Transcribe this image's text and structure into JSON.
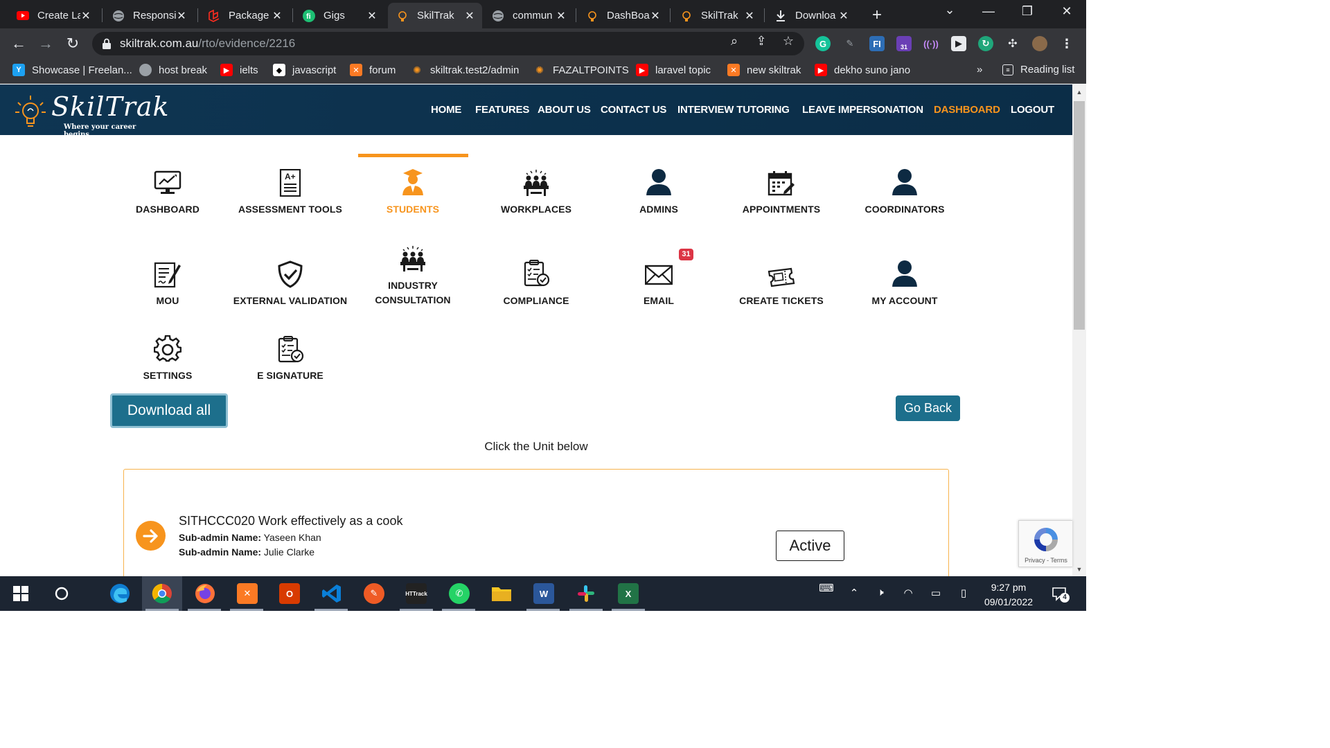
{
  "browser": {
    "tabs": [
      {
        "title": "Create La",
        "icon": "youtube-icon"
      },
      {
        "title": "Responsi",
        "icon": "globe-icon"
      },
      {
        "title": "Package",
        "icon": "laravel-icon"
      },
      {
        "title": "Gigs",
        "icon": "fiverr-icon"
      },
      {
        "title": "SkilTrak",
        "icon": "skiltrak-icon"
      },
      {
        "title": "commun",
        "icon": "globe-icon"
      },
      {
        "title": "DashBoa",
        "icon": "skiltrak-icon"
      },
      {
        "title": "SkilTrak",
        "icon": "skiltrak-icon"
      },
      {
        "title": "Downloa",
        "icon": "download-icon"
      }
    ],
    "url_host": "skiltrak.com.au",
    "url_path": "/rto/evidence/2216",
    "bookmarks": [
      {
        "label": "Showcase | Freelan...",
        "icon": "freelancer-icon"
      },
      {
        "label": "host break",
        "icon": "globe-icon"
      },
      {
        "label": "ielts",
        "icon": "youtube-icon"
      },
      {
        "label": "javascript",
        "icon": "bookmark-icon"
      },
      {
        "label": "forum",
        "icon": "xampp-icon"
      },
      {
        "label": "skiltrak.test2/admin",
        "icon": "skiltrak-icon"
      },
      {
        "label": "FAZALTPOINTS",
        "icon": "skiltrak-icon"
      },
      {
        "label": "laravel topic",
        "icon": "youtube-icon"
      },
      {
        "label": "new skiltrak",
        "icon": "xampp-icon"
      },
      {
        "label": "dekho suno jano",
        "icon": "youtube-icon"
      }
    ],
    "bookmarks_overflow": "»",
    "reading_list": "Reading list",
    "ext_calendar_badge": "31"
  },
  "site": {
    "logo_text": "SkilTrak",
    "logo_tagline": "Where your career begins",
    "nav": [
      "HOME",
      "FEATURES",
      "ABOUT US",
      "CONTACT US",
      "INTERVIEW TUTORING",
      "LEAVE IMPERSONATION",
      "DASHBOARD",
      "LOGOUT"
    ],
    "active_nav": "DASHBOARD",
    "accent_color": "#f7941d",
    "header_color": "#0e3552"
  },
  "dashboard": {
    "items": [
      {
        "label": "DASHBOARD",
        "icon": "dashboard-monitor-icon"
      },
      {
        "label": "ASSESSMENT TOOLS",
        "icon": "assessment-tools-icon"
      },
      {
        "label": "STUDENTS",
        "icon": "student-icon"
      },
      {
        "label": "WORKPLACES",
        "icon": "workplaces-icon"
      },
      {
        "label": "ADMINS",
        "icon": "user-icon"
      },
      {
        "label": "APPOINTMENTS",
        "icon": "calendar-icon"
      },
      {
        "label": "COORDINATORS",
        "icon": "user-icon"
      },
      {
        "label": "MOU",
        "icon": "mou-document-icon"
      },
      {
        "label": "EXTERNAL VALIDATION",
        "icon": "shield-check-icon"
      },
      {
        "label": "INDUSTRY CONSULTATION",
        "icon": "meeting-icon"
      },
      {
        "label": "COMPLIANCE",
        "icon": "clipboard-check-icon"
      },
      {
        "label": "EMAIL",
        "icon": "envelope-icon"
      },
      {
        "label": "CREATE TICKETS",
        "icon": "ticket-icon"
      },
      {
        "label": "MY ACCOUNT",
        "icon": "user-icon"
      },
      {
        "label": "SETTINGS",
        "icon": "gear-icon"
      },
      {
        "label": "E SIGNATURE",
        "icon": "clipboard-check-icon"
      }
    ],
    "selected": "STUDENTS",
    "email_badge": "31"
  },
  "main": {
    "download_all": "Download all",
    "go_back": "Go Back",
    "click_unit": "Click the Unit below",
    "unit": {
      "title": "SITHCCC020 Work effectively as a cook",
      "subadmin_label": "Sub-admin Name:",
      "subadmins": [
        "Yaseen Khan",
        "Julie Clarke"
      ],
      "status": "Active"
    },
    "recaptcha_text": "Privacy - Terms"
  },
  "taskbar": {
    "time": "9:27 pm",
    "date": "09/01/2022",
    "notifications": "4",
    "apps": [
      "start-icon",
      "cortana-icon",
      "edge-icon",
      "chrome-icon",
      "firefox-icon",
      "xampp-icon",
      "office-icon",
      "vscode-icon",
      "postman-icon",
      "html-copier-icon",
      "whatsapp-icon",
      "file-explorer-icon",
      "word-icon",
      "slack-icon",
      "excel-icon"
    ]
  }
}
